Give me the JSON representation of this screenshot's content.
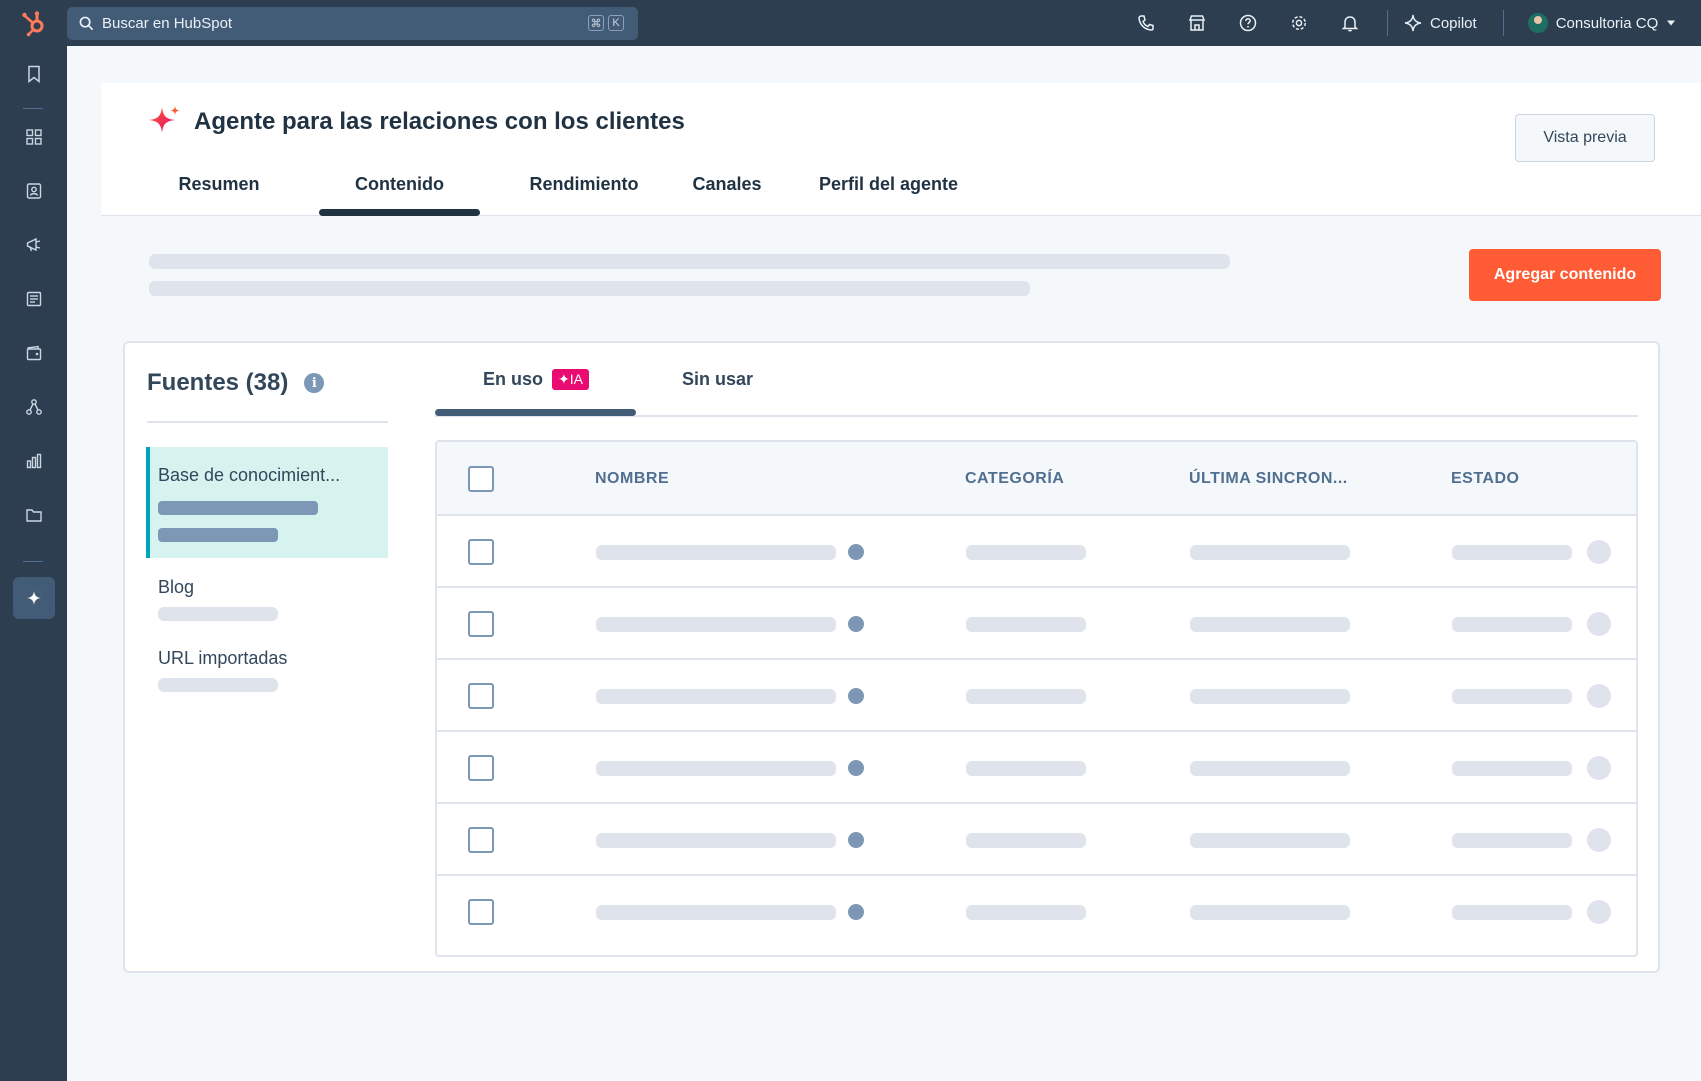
{
  "topbar": {
    "search_placeholder": "Buscar en HubSpot",
    "kbd_keys": [
      "⌘",
      "K"
    ],
    "icons": [
      "phone-icon",
      "marketplace-icon",
      "help-icon",
      "settings-icon",
      "notifications-icon"
    ],
    "copilot_label": "Copilot",
    "account_name": "Consultoria CQ"
  },
  "sidenav": {
    "icons": [
      "bookmark-icon",
      "workspaces-icon",
      "contacts-icon",
      "marketing-icon",
      "content-icon",
      "commerce-icon",
      "automation-icon",
      "reporting-icon",
      "library-icon",
      "breeze-agents-icon"
    ]
  },
  "header": {
    "title": "Agente para las relaciones con los clientes",
    "preview_label": "Vista previa",
    "tabs": [
      {
        "label": "Resumen",
        "active": false
      },
      {
        "label": "Contenido",
        "active": true
      },
      {
        "label": "Rendimiento",
        "active": false
      },
      {
        "label": "Canales",
        "active": false
      },
      {
        "label": "Perfil del agente",
        "active": false
      }
    ]
  },
  "content": {
    "add_button_label": "Agregar contenido",
    "sources_title": "Fuentes (38)",
    "sources": [
      {
        "label": "Base de conocimient...",
        "active": true
      },
      {
        "label": "Blog",
        "active": false
      },
      {
        "label": "URL importadas",
        "active": false
      }
    ],
    "subtabs": [
      {
        "label": "En uso",
        "badge": "✦IA",
        "active": true
      },
      {
        "label": "Sin usar",
        "active": false
      }
    ],
    "table": {
      "columns": [
        "NOMBRE",
        "CATEGORÍA",
        "ÚLTIMA SINCRON...",
        "ESTADO"
      ],
      "row_count": 6
    }
  },
  "colors": {
    "nav_bg": "#2d3e50",
    "accent_orange": "#ff5c35",
    "ia_pink": "#ea0b72",
    "active_source_bg": "#d6f3f0",
    "active_source_border": "#00a4bd"
  }
}
